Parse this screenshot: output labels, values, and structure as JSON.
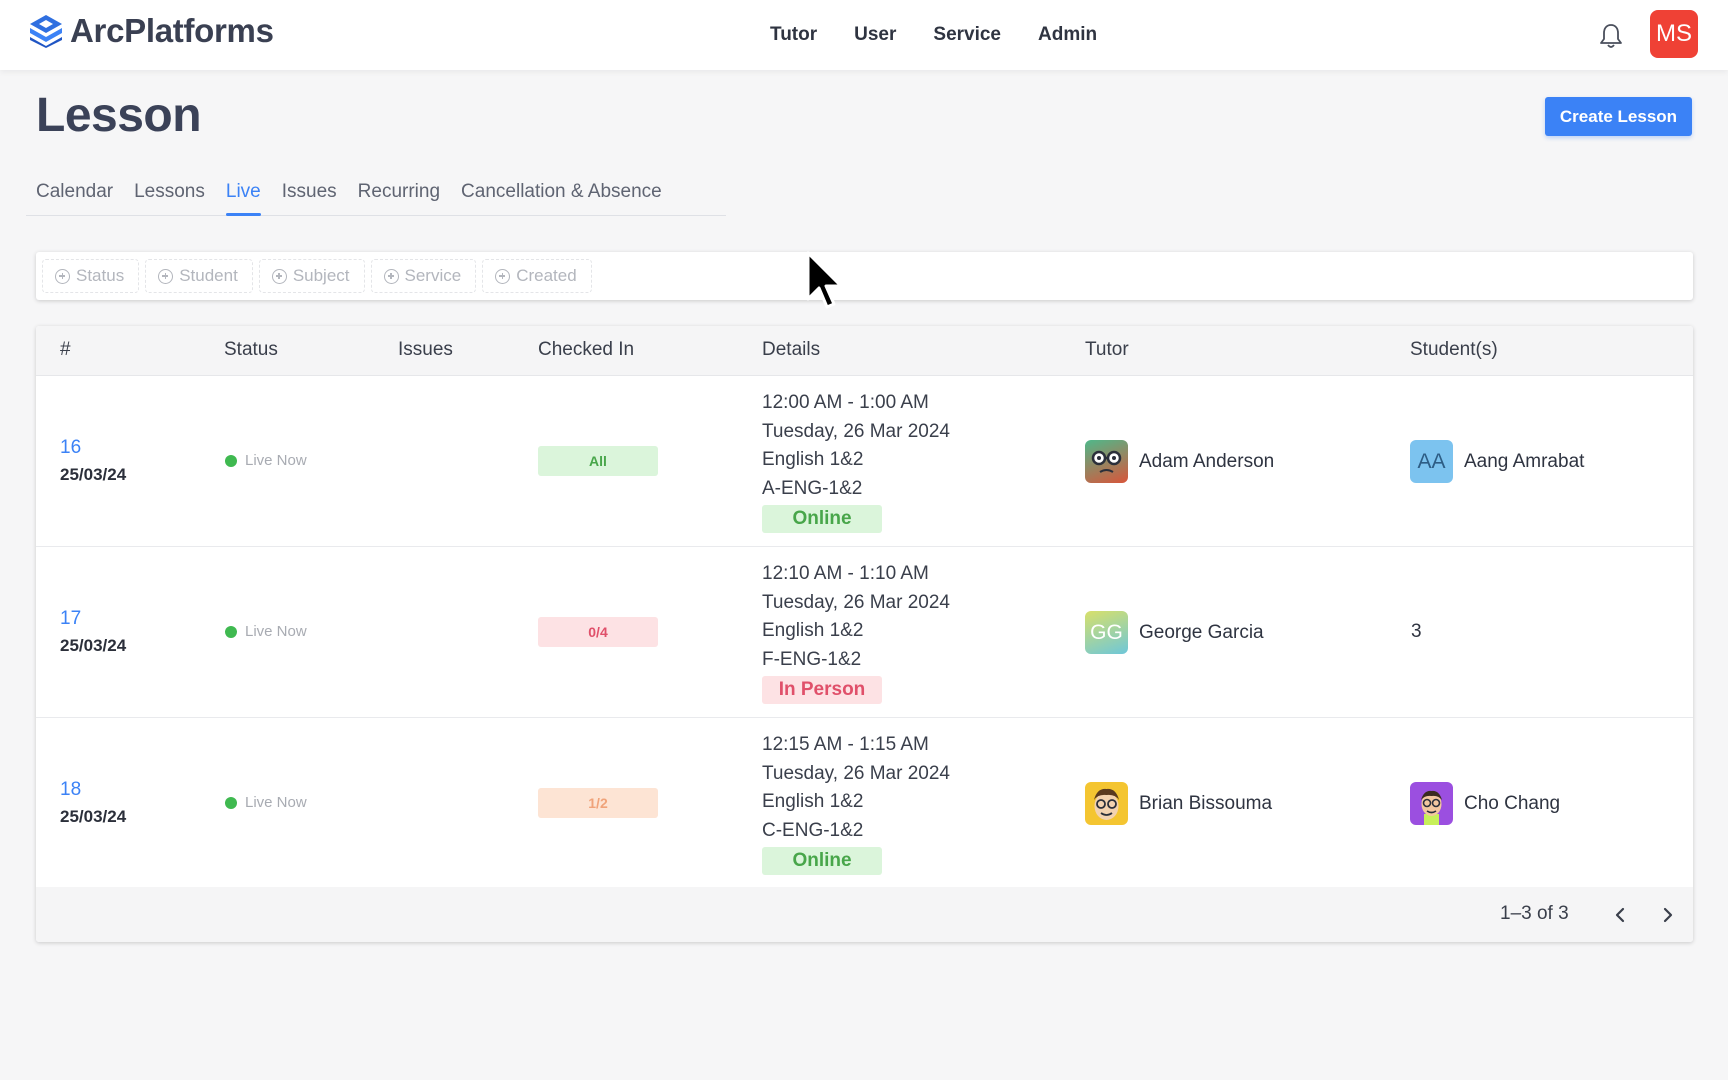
{
  "app": {
    "brand": "ArcPlatforms"
  },
  "nav": {
    "items": [
      "Tutor",
      "User",
      "Service",
      "Admin"
    ]
  },
  "user": {
    "initials": "MS"
  },
  "page": {
    "title": "Lesson",
    "create_label": "Create Lesson"
  },
  "tabs": [
    "Calendar",
    "Lessons",
    "Live",
    "Issues",
    "Recurring",
    "Cancellation & Absence"
  ],
  "active_tab": "Live",
  "filters": [
    "Status",
    "Student",
    "Subject",
    "Service",
    "Created"
  ],
  "table": {
    "headers": [
      "#",
      "Status",
      "Issues",
      "Checked In",
      "Details",
      "Tutor",
      "Student(s)"
    ],
    "rows": [
      {
        "id": "16",
        "date": "25/03/24",
        "status": "Live Now",
        "checked_in": "All",
        "time": "12:00 AM - 1:00 AM",
        "day": "Tuesday, 26 Mar 2024",
        "subject": "English 1&2",
        "code": "A-ENG-1&2",
        "mode": "Online",
        "tutor": "Adam Anderson",
        "student": "Aang Amrabat",
        "student_initials": "AA"
      },
      {
        "id": "17",
        "date": "25/03/24",
        "status": "Live Now",
        "checked_in": "0/4",
        "time": "12:10 AM - 1:10 AM",
        "day": "Tuesday, 26 Mar 2024",
        "subject": "English 1&2",
        "code": "F-ENG-1&2",
        "mode": "In Person",
        "tutor": "George Garcia",
        "tutor_initials": "GG",
        "student_count": "3"
      },
      {
        "id": "18",
        "date": "25/03/24",
        "status": "Live Now",
        "checked_in": "1/2",
        "time": "12:15 AM - 1:15 AM",
        "day": "Tuesday, 26 Mar 2024",
        "subject": "English 1&2",
        "code": "C-ENG-1&2",
        "mode": "Online",
        "tutor": "Brian Bissouma",
        "student": "Cho Chang"
      }
    ]
  },
  "pagination": {
    "info": "1–3 of 3"
  },
  "colors": {
    "accent": "#3b82f6",
    "live": "#3fb950",
    "user_avatar": "#ef4135"
  }
}
